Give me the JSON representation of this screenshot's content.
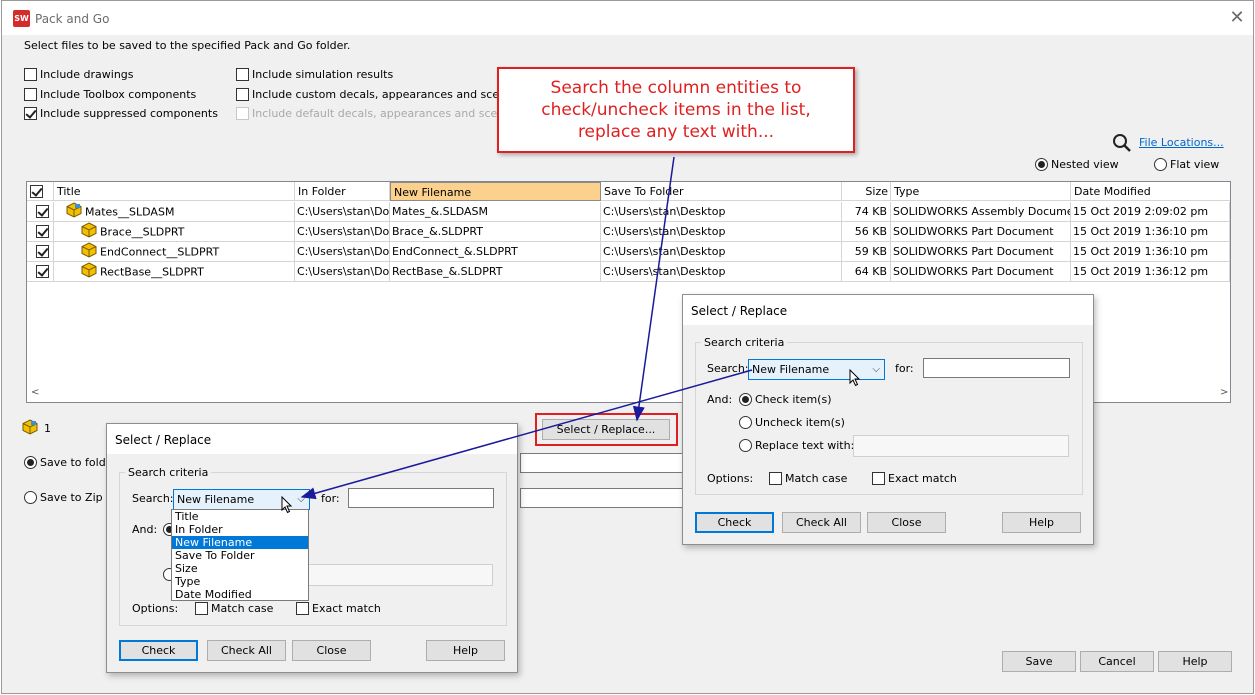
{
  "window": {
    "title": "Pack and Go",
    "app_icon": "SW"
  },
  "instruction": "Select files to be saved to the specified Pack and Go folder.",
  "options_left": [
    {
      "label": "Include drawings",
      "checked": false
    },
    {
      "label": "Include Toolbox components",
      "checked": false
    },
    {
      "label": "Include suppressed components",
      "checked": true
    }
  ],
  "options_right": [
    {
      "label": "Include simulation results",
      "checked": false,
      "disabled": false
    },
    {
      "label": "Include custom decals, appearances and scenes",
      "checked": false,
      "disabled": false
    },
    {
      "label": "Include default decals, appearances and scenes",
      "checked": false,
      "disabled": true
    }
  ],
  "callout": {
    "line1": "Search the column entities to",
    "line2": "check/uncheck items in the list,",
    "line3": "replace any text with..."
  },
  "file_locations": "File Locations...",
  "view": {
    "nested": "Nested view",
    "flat": "Flat view",
    "selected": "nested"
  },
  "table": {
    "headers": [
      "Title",
      "In Folder",
      "New Filename",
      "Save To Folder",
      "Size",
      "Type",
      "Date Modified"
    ],
    "rows": [
      {
        "title": "Mates__SLDASM",
        "in_folder": "C:\\Users\\stan\\Doc",
        "new_filename": "Mates_&.SLDASM",
        "save_to": "C:\\Users\\stan\\Desktop",
        "size": "74 KB",
        "type": "SOLIDWORKS Assembly Document",
        "date": "15 Oct 2019 2:09:02 pm"
      },
      {
        "title": "Brace__SLDPRT",
        "in_folder": "C:\\Users\\stan\\Doc",
        "new_filename": "Brace_&.SLDPRT",
        "save_to": "C:\\Users\\stan\\Desktop",
        "size": "56 KB",
        "type": "SOLIDWORKS Part Document",
        "date": "15 Oct 2019 1:36:10 pm"
      },
      {
        "title": "EndConnect__SLDPRT",
        "in_folder": "C:\\Users\\stan\\Doc",
        "new_filename": "EndConnect_&.SLDPRT",
        "save_to": "C:\\Users\\stan\\Desktop",
        "size": "59 KB",
        "type": "SOLIDWORKS Part Document",
        "date": "15 Oct 2019 1:36:10 pm"
      },
      {
        "title": "RectBase__SLDPRT",
        "in_folder": "C:\\Users\\stan\\Doc",
        "new_filename": "RectBase_&.SLDPRT",
        "save_to": "C:\\Users\\stan\\Desktop",
        "size": "64 KB",
        "type": "SOLIDWORKS Part Document",
        "date": "15 Oct 2019 1:36:12 pm"
      }
    ]
  },
  "count": "1",
  "save_folder": "Save to fold",
  "save_zip": "Save to Zip f",
  "select_replace_btn": "Select / Replace...",
  "bottom_buttons": {
    "save": "Save",
    "cancel": "Cancel",
    "help": "Help"
  },
  "dialog": {
    "title": "Select / Replace",
    "group": "Search criteria",
    "search_label": "Search:",
    "search_value": "New Filename",
    "for_label": "for:",
    "and_label": "And:",
    "check_items": "Check item(s)",
    "uncheck_items": "Uncheck item(s)",
    "replace_text": "Replace text with:",
    "options_label": "Options:",
    "match_case": "Match case",
    "exact_match": "Exact match",
    "btn_check": "Check",
    "btn_check_all": "Check All",
    "btn_close": "Close",
    "btn_help": "Help"
  },
  "dropdown_options": [
    "Title",
    "In Folder",
    "New Filename",
    "Save To Folder",
    "Size",
    "Type",
    "Date Modified"
  ],
  "colors": {
    "accent": "#0078d7",
    "callout_red": "#e02020",
    "header_selected": "#fcd18d",
    "arrow": "#1a1a9c"
  }
}
